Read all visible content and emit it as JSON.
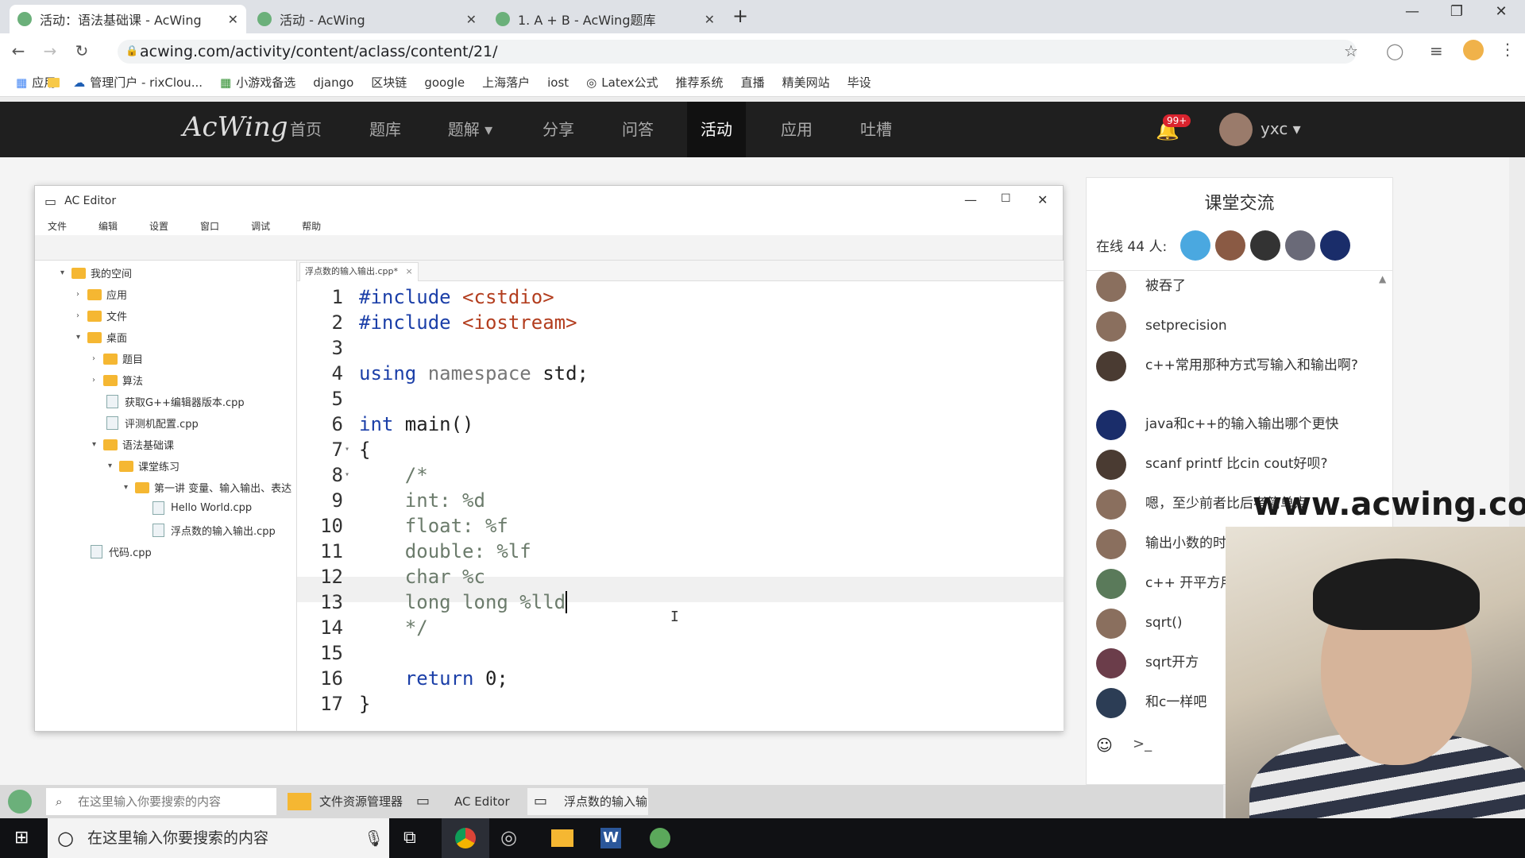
{
  "browser": {
    "tabs": [
      {
        "title": "活动：语法基础课 - AcWing",
        "active": true
      },
      {
        "title": "活动 - AcWing",
        "active": false
      },
      {
        "title": "1. A + B - AcWing题库",
        "active": false
      }
    ],
    "url": "acwing.com/activity/content/aclass/content/21/",
    "bookmarks": [
      "应用",
      "管理门户 - rixClou...",
      "小游戏备选",
      "django",
      "区块链",
      "google",
      "上海落户",
      "iost",
      "Latex公式",
      "推荐系统",
      "直播",
      "精美网站",
      "毕设"
    ]
  },
  "site": {
    "logo": "AcWing",
    "nav": [
      "首页",
      "题库",
      "题解 ▾",
      "分享",
      "问答",
      "活动",
      "应用",
      "吐槽"
    ],
    "active_nav": "活动",
    "notification_count": "99+",
    "username": "yxc ▾"
  },
  "editor": {
    "title": "AC Editor",
    "menu": [
      "文件",
      "编辑",
      "设置",
      "窗口",
      "调试",
      "帮助"
    ],
    "open_tab": "浮点数的输入输出.cpp*",
    "tree": [
      {
        "label": "我的空间",
        "type": "folder",
        "open": true
      },
      {
        "label": "应用",
        "type": "folder"
      },
      {
        "label": "文件",
        "type": "folder"
      },
      {
        "label": "桌面",
        "type": "folder",
        "open": true
      },
      {
        "label": "题目",
        "type": "folder"
      },
      {
        "label": "算法",
        "type": "folder"
      },
      {
        "label": "获取G++编辑器版本.cpp",
        "type": "file"
      },
      {
        "label": "评测机配置.cpp",
        "type": "file"
      },
      {
        "label": "语法基础课",
        "type": "folder",
        "open": true
      },
      {
        "label": "课堂练习",
        "type": "folder",
        "open": true
      },
      {
        "label": "第一讲 变量、输入输出、表达",
        "type": "folder",
        "open": true
      },
      {
        "label": "Hello World.cpp",
        "type": "file"
      },
      {
        "label": "浮点数的输入输出.cpp",
        "type": "file"
      },
      {
        "label": "代码.cpp",
        "type": "file"
      }
    ],
    "code_lines": [
      "#include <cstdio>",
      "#include <iostream>",
      "",
      "using namespace std;",
      "",
      "int main()",
      "{",
      "    /*",
      "    int: %d",
      "    float: %f",
      "    double: %lf",
      "    char %c",
      "    long long %lld",
      "    */",
      "",
      "    return 0;",
      "}"
    ],
    "current_line": 13
  },
  "chat": {
    "title": "课堂交流",
    "online": "在线 44 人:",
    "messages": [
      "被吞了",
      "setprecision",
      "c++常用那种方式写输入和输出啊?",
      "java和c++的输入输出哪个更快",
      "scanf printf 比cin cout好呗?",
      "嗯，至少前者比后者简单点",
      "输出小数的时",
      "c++ 开平方用",
      "sqrt()",
      "sqrt开方",
      "和c一样吧"
    ]
  },
  "watermark": "www.acwing.com",
  "inner_taskbar": {
    "search_placeholder": "在这里输入你要搜索的内容",
    "items": [
      "文件资源管理器",
      "AC Editor",
      "浮点数的输入输"
    ]
  },
  "windows_taskbar": {
    "search_placeholder": "在这里输入你要搜索的内容"
  }
}
